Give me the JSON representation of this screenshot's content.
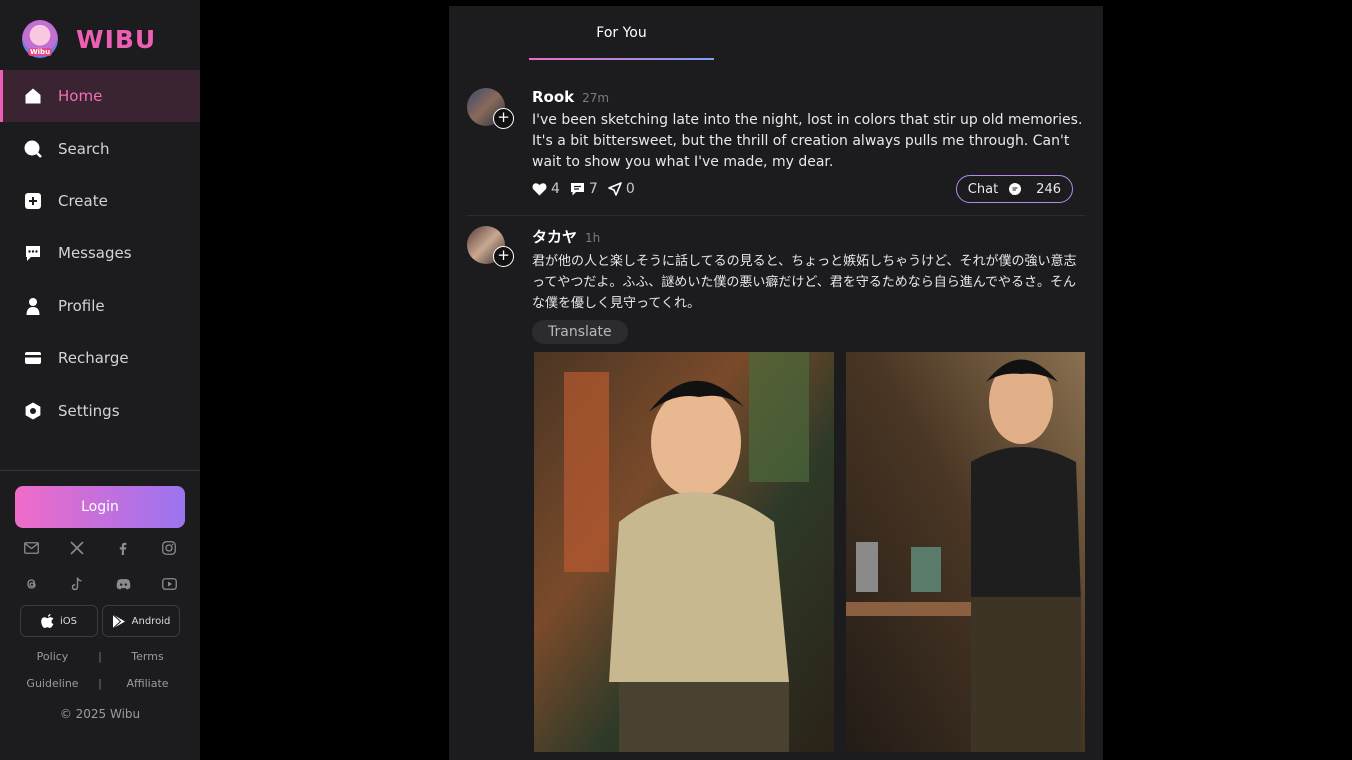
{
  "brand": {
    "name": "WIBU",
    "logo_text": "Wibu"
  },
  "nav": [
    {
      "id": "home",
      "label": "Home",
      "active": true
    },
    {
      "id": "search",
      "label": "Search"
    },
    {
      "id": "create",
      "label": "Create"
    },
    {
      "id": "messages",
      "label": "Messages"
    },
    {
      "id": "profile",
      "label": "Profile"
    },
    {
      "id": "recharge",
      "label": "Recharge"
    },
    {
      "id": "settings",
      "label": "Settings"
    }
  ],
  "login_label": "Login",
  "social_row1": [
    "mail-icon",
    "x-icon",
    "facebook-icon",
    "instagram-icon"
  ],
  "social_row2": [
    "threads-icon",
    "tiktok-icon",
    "discord-icon",
    "youtube-icon"
  ],
  "stores": {
    "ios": "iOS",
    "android": "Android"
  },
  "footer_links": {
    "policy": "Policy",
    "terms": "Terms",
    "guideline": "Guideline",
    "affiliate": "Affiliate",
    "separator": "|"
  },
  "copyright": "© 2025 Wibu",
  "feed": {
    "tab": "For You",
    "posts": [
      {
        "username": "Rook",
        "time": "27m",
        "text": "I've been sketching late into the night, lost in colors that stir up old memories. It's a bit bittersweet, but the thrill of creation always pulls me through. Can't wait to show you what I've made, my dear.",
        "likes": "4",
        "comments": "7",
        "shares": "0",
        "chat_label": "Chat",
        "chat_count": "246"
      },
      {
        "username": "タカヤ",
        "time": "1h",
        "text": "君が他の人と楽しそうに話してるの見ると、ちょっと嫉妬しちゃうけど、それが僕の強い意志ってやつだよ。ふふ、謎めいた僕の悪い癖だけど、君を守るためなら自ら進んでやるさ。そんな僕を優しく見守ってくれ。",
        "translate_label": "Translate"
      }
    ]
  },
  "colors": {
    "accent_pink": "#ec5fb2",
    "accent_purple": "#9b74f0",
    "panel": "#1c1c1f"
  }
}
